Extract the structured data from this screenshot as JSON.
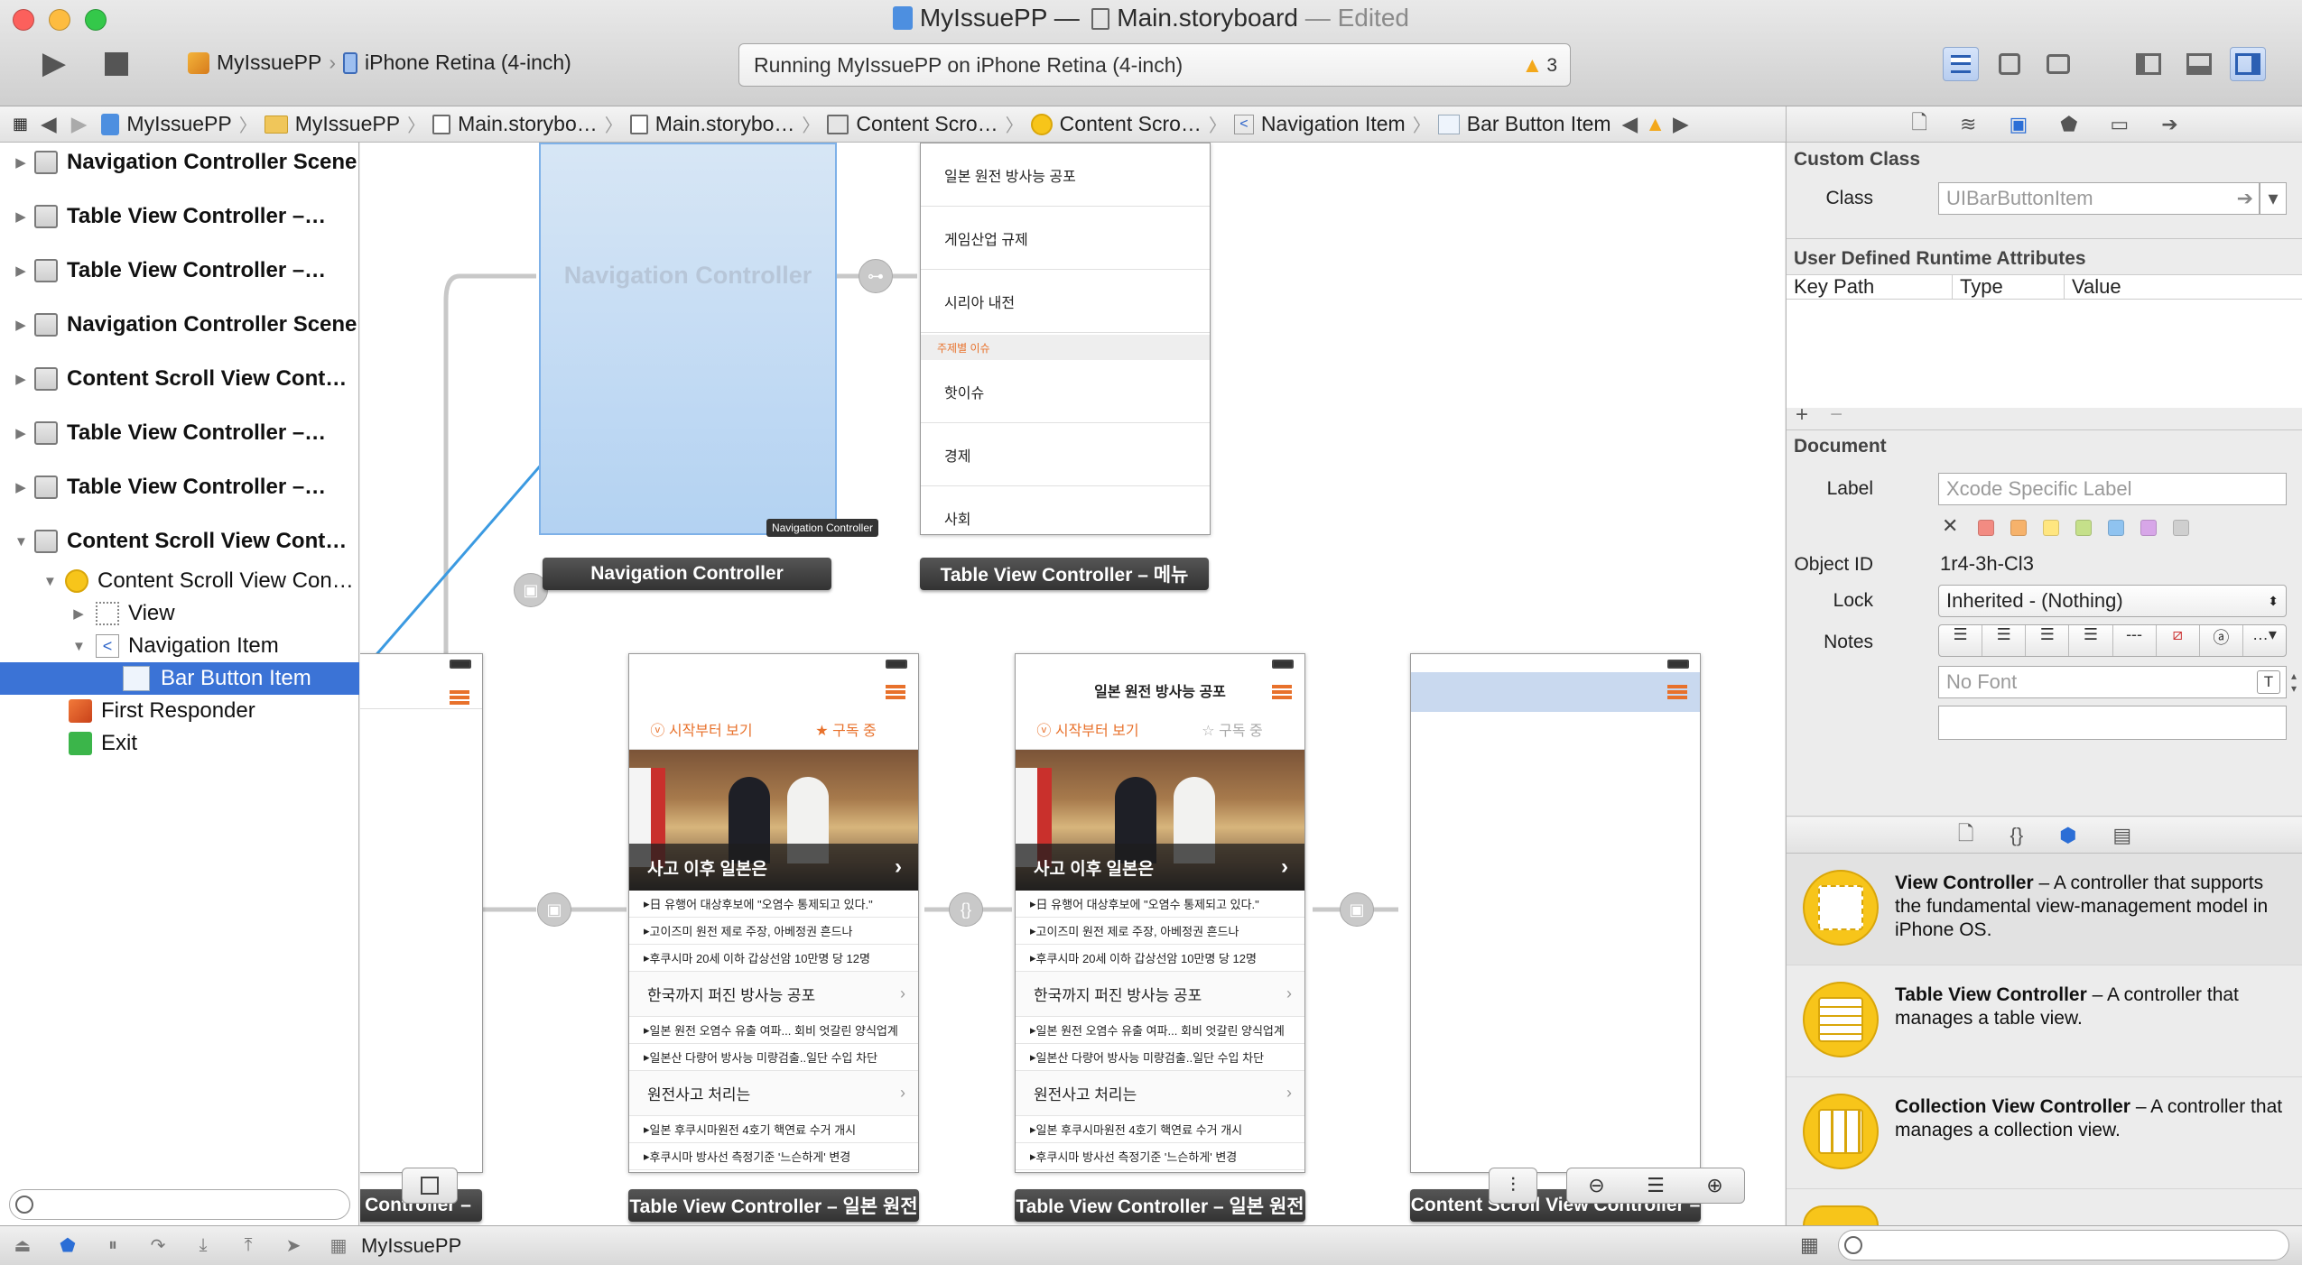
{
  "window": {
    "project": "MyIssuePP",
    "dash": "—",
    "file": "Main.storyboard",
    "edited": "— Edited"
  },
  "toolbar": {
    "scheme_target": "MyIssuePP",
    "scheme_device": "iPhone Retina (4-inch)",
    "status": "Running MyIssuePP on iPhone Retina (4-inch)",
    "warning_count": "3"
  },
  "jumpbar": {
    "crumbs": [
      "MyIssuePP",
      "MyIssuePP",
      "Main.storybo…",
      "Main.storybo…",
      "Content Scro…",
      "Content Scro…",
      "Navigation Item",
      "Bar Button Item"
    ]
  },
  "navigator": {
    "rows": [
      "Navigation Controller Scene",
      "Table View Controller –…",
      "Table View Controller –…",
      "Navigation Controller Scene",
      "Content Scroll View Cont…",
      "Table View Controller –…",
      "Table View Controller –…",
      "Content Scroll View Cont…",
      "Content Scroll View Con…",
      "View",
      "Navigation Item",
      "Bar Button Item",
      "First Responder",
      "Exit"
    ]
  },
  "canvas": {
    "nav_controller_title": "Navigation Controller",
    "nav_controller_tag": "Navigation Controller",
    "label_nav": "Navigation Controller",
    "label_menu": "Table View Controller – 메뉴",
    "menu_items": [
      "일본 원전 방사능 공포",
      "게임산업 규제",
      "시리아 내전"
    ],
    "menu_section": "주제별 이슈",
    "menu_items2": [
      "핫이슈",
      "경제",
      "사회"
    ],
    "seg_start": "시작부터 보기",
    "seg_subscribe": "구독 중",
    "hero_caption": "사고 이후 일본은",
    "news1": [
      "日 유행어 대상후보에 \"오염수 통제되고 있다.\"",
      "고이즈미 원전 제로 주장, 아베정권 흔드나",
      "후쿠시마 20세 이하 갑상선암 10만명 당 12명"
    ],
    "header2": "한국까지 퍼진 방사능 공포",
    "news2": [
      "일본 원전 오염수 유출 여파... 회비 엇갈린 양식업계",
      "일본산 다량어 방사능 미량검출..일단 수입 차단"
    ],
    "header3": "원전사고 처리는",
    "news3": [
      "일본 후쿠시마원전 4호기 핵연료 수거 개시",
      "후쿠시마 방사선 측정기준 '느슨하게' 변경"
    ],
    "phone3_title": "일본 원전 방사능 공포",
    "label_left": "w Controller –",
    "label_p2": "Table View Controller – 일본 원전",
    "label_p3": "Table View Controller – 일본 원전",
    "label_p4": "Content Scroll View Controller –"
  },
  "inspector": {
    "custom_class_head": "Custom Class",
    "class_label": "Class",
    "class_placeholder": "UIBarButtonItem",
    "udra_head": "User Defined Runtime Attributes",
    "col_keypath": "Key Path",
    "col_type": "Type",
    "col_value": "Value",
    "add": "+",
    "remove": "−",
    "document_head": "Document",
    "label_label": "Label",
    "label_placeholder": "Xcode Specific Label",
    "objectid_label": "Object ID",
    "objectid_value": "1r4-3h-Cl3",
    "lock_label": "Lock",
    "lock_value": "Inherited - (Nothing)",
    "notes_label": "Notes",
    "font_placeholder": "No Font",
    "swatch_colors": [
      "#f28b82",
      "#f6b26b",
      "#ffe680",
      "#c5e08a",
      "#8fc3f0",
      "#d7a6e8",
      "#cfcfcf"
    ]
  },
  "library": [
    {
      "title": "View Controller",
      "desc": " – A controller that supports the fundamental view-management model in iPhone OS."
    },
    {
      "title": "Table View Controller",
      "desc": " – A controller that manages a table view."
    },
    {
      "title": "Collection View Controller",
      "desc": " – A controller that manages a collection view."
    }
  ],
  "bottombar": {
    "target": "MyIssuePP"
  }
}
